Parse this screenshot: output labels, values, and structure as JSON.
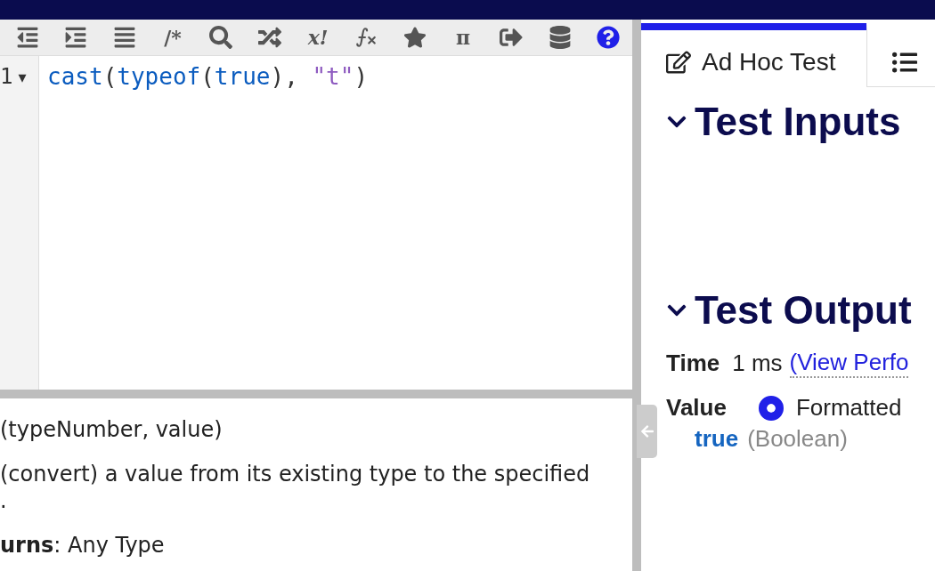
{
  "toolbar": [
    {
      "kind": "icon"
    },
    {
      "kind": "icon"
    },
    {
      "kind": "icon"
    },
    {
      "kind": "text",
      "label": "/*"
    },
    {
      "kind": "icon"
    },
    {
      "kind": "icon"
    },
    {
      "kind": "text",
      "label": "x!"
    },
    {
      "kind": "icon"
    },
    {
      "kind": "icon"
    },
    {
      "kind": "text",
      "label": "π"
    },
    {
      "kind": "icon"
    },
    {
      "kind": "icon"
    },
    {
      "kind": "help"
    }
  ],
  "editor": {
    "lines": [
      {
        "number": "1",
        "fold": "▾",
        "tokens": [
          {
            "text": "cast",
            "kind": "fn"
          },
          {
            "text": "(",
            "kind": "punct"
          },
          {
            "text": "typeof",
            "kind": "fn"
          },
          {
            "text": "(",
            "kind": "punct"
          },
          {
            "text": "true",
            "kind": "fn"
          },
          {
            "text": "), ",
            "kind": "punct"
          },
          {
            "text": "\"t\"",
            "kind": "string"
          },
          {
            "text": ")",
            "kind": "punct"
          }
        ]
      }
    ]
  },
  "docs": {
    "signature": "(typeNumber, value)",
    "description": [
      "(convert) a value from its existing type to the specified",
      "."
    ],
    "returns": "**urns**: Any Type"
  },
  "tabs": [
    {
      "label": "Ad Hoc Test",
      "selected": true
    },
    {
      "selected": false
    }
  ],
  "sections": [
    {
      "title": "Test Inputs",
      "expanded": true
    },
    {
      "title": "Test Output",
      "expanded": true
    }
  ],
  "output": {
    "time_label": "Time",
    "time_value": "1 ms",
    "time_link": "(View Perfo",
    "value_label": "Value",
    "format": {
      "label": "Formatted",
      "selected": true
    },
    "result": "true",
    "result_type": "(Boolean)"
  }
}
